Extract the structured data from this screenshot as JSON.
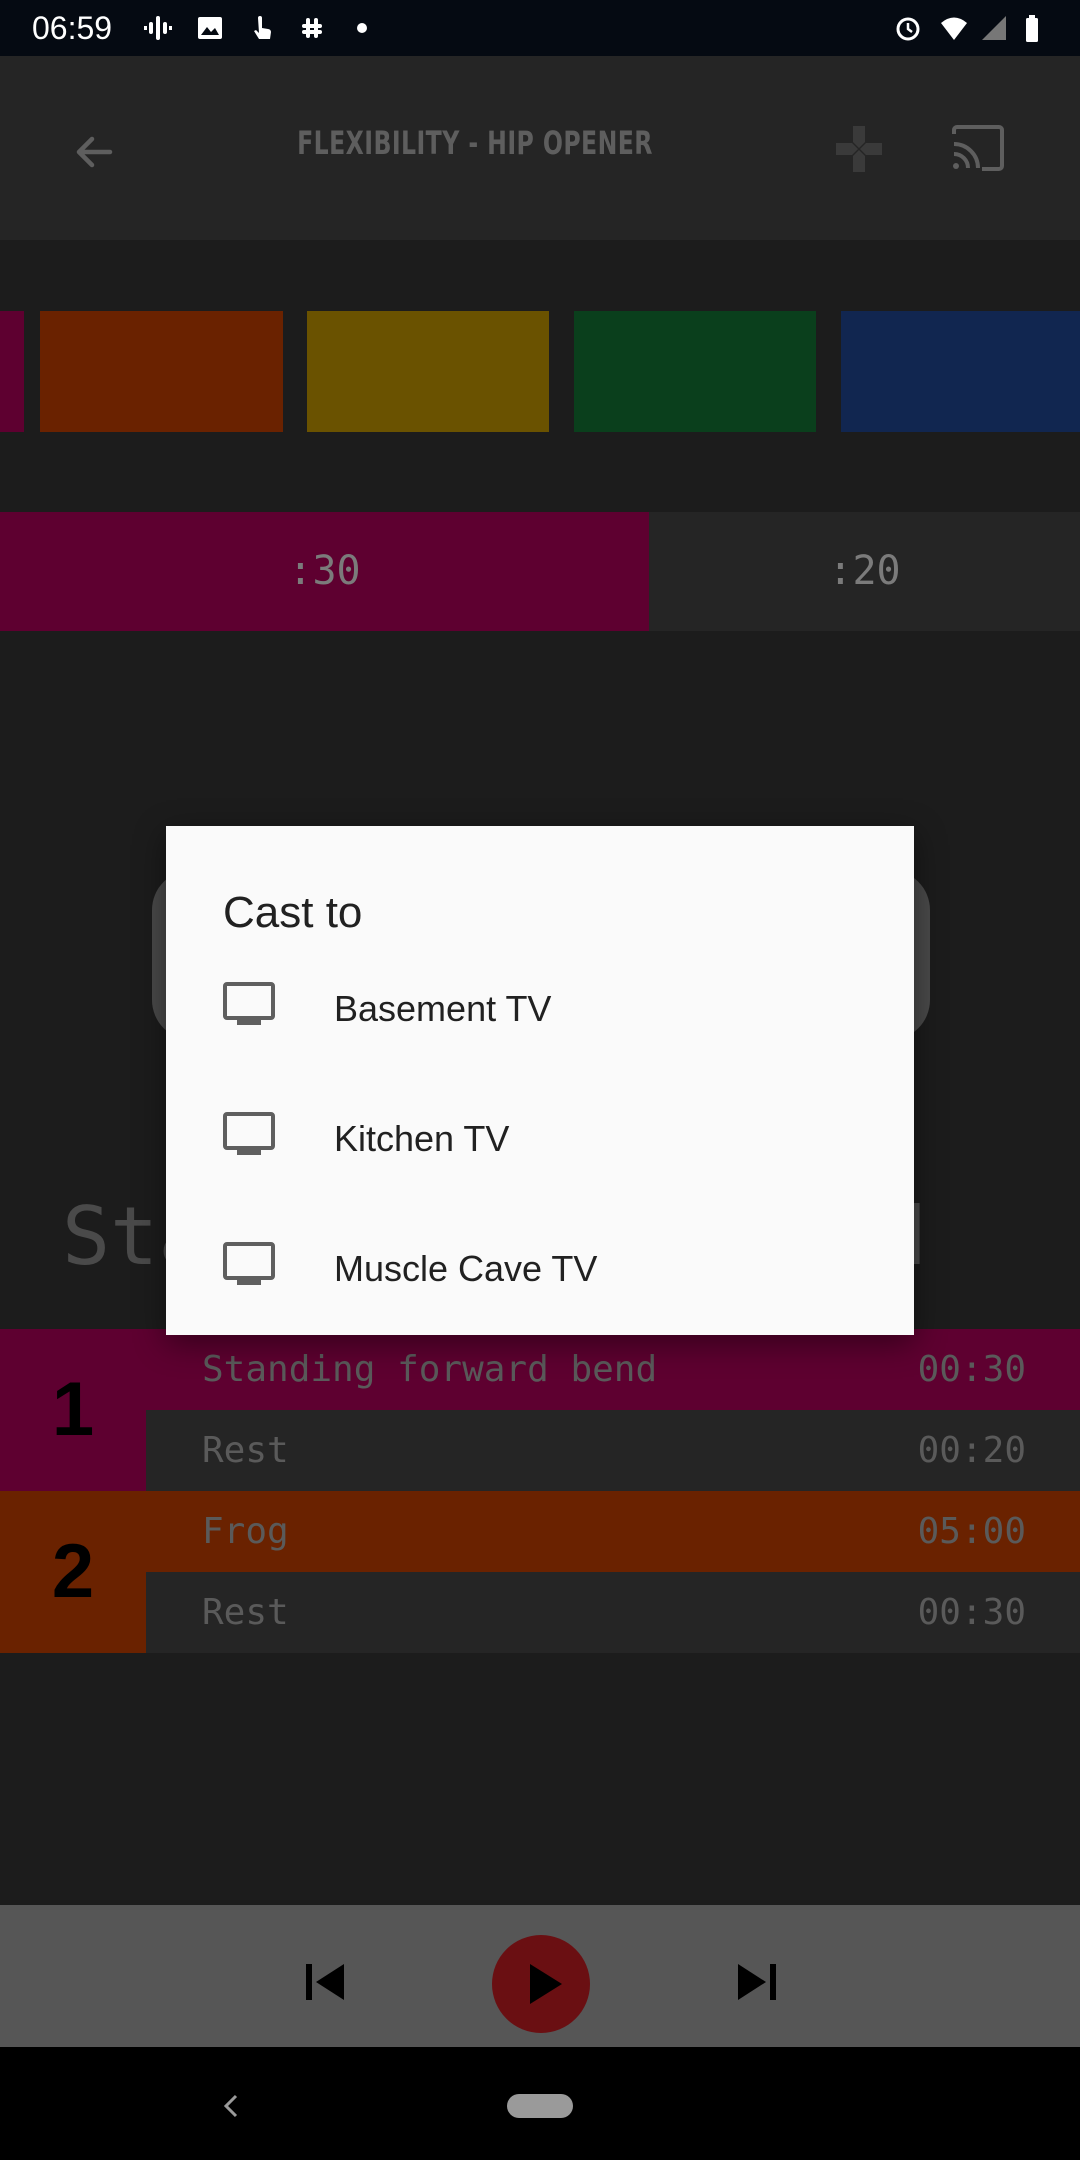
{
  "status_bar": {
    "time": "06:59"
  },
  "app_bar": {
    "title": "FLEXIBILITY - HIP OPENER"
  },
  "strip": {
    "colors": [
      "#5e0030",
      "#6a2200",
      "#6a5200",
      "#0a3f1c",
      "#112650"
    ]
  },
  "timer": {
    "current": ":30",
    "next": ":20",
    "current_color": "#5e0030"
  },
  "background_text": {
    "exercise_prefix": "Sta",
    "exercise_suffix": "end"
  },
  "schedule": [
    {
      "number": "1",
      "color": "#5e0030",
      "rows": [
        {
          "name": "Standing forward bend",
          "time": "00:30"
        },
        {
          "name": "Rest",
          "time": "00:20"
        }
      ]
    },
    {
      "number": "2",
      "color": "#6a2200",
      "rows": [
        {
          "name": "Frog",
          "time": "05:00"
        },
        {
          "name": "Rest",
          "time": "00:30"
        }
      ]
    }
  ],
  "dialog": {
    "title": "Cast to",
    "devices": [
      {
        "label": "Basement TV",
        "icon": "tv-icon"
      },
      {
        "label": "Kitchen TV",
        "icon": "tv-icon"
      },
      {
        "label": "Muscle Cave TV",
        "icon": "tv-icon"
      }
    ]
  }
}
